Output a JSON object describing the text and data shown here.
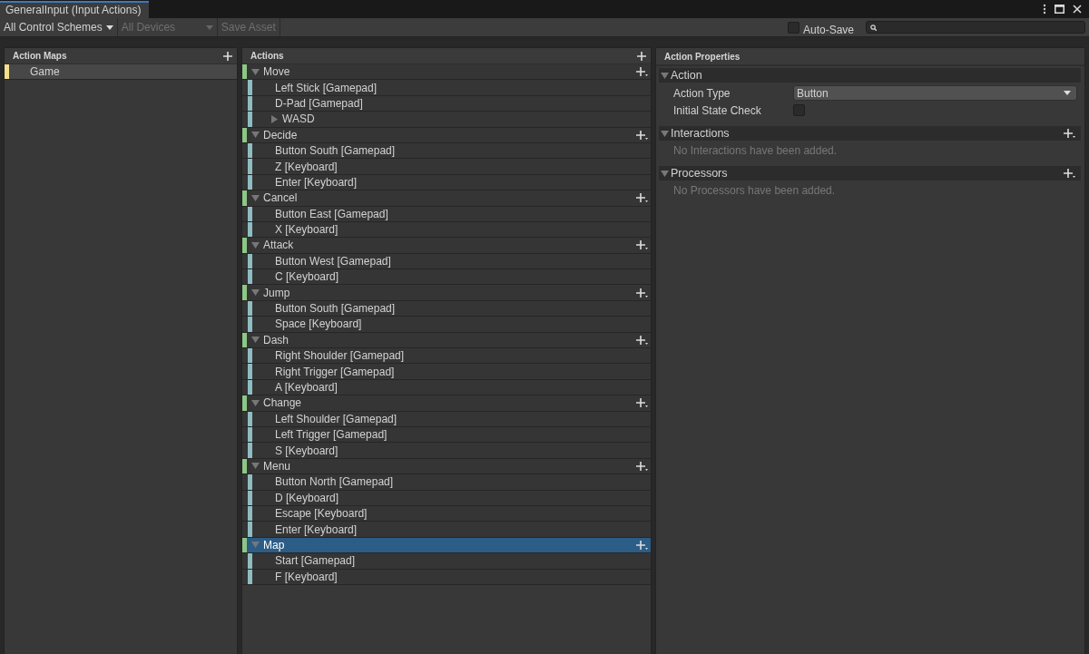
{
  "window": {
    "title": "GeneralInput (Input Actions)"
  },
  "toolbar": {
    "control_scheme": "All Control Schemes",
    "devices": "All Devices",
    "devices_disabled": true,
    "save_asset": "Save Asset",
    "save_disabled": true,
    "auto_save": {
      "label": "Auto-Save",
      "checked": false
    }
  },
  "action_maps": {
    "title": "Action Maps",
    "items": [
      {
        "name": "Game",
        "selected": false
      }
    ]
  },
  "actions": {
    "title": "Actions",
    "items": [
      {
        "name": "Move",
        "expanded": true,
        "selected": false,
        "children": [
          {
            "name": "Left Stick [Gamepad]"
          },
          {
            "name": "D-Pad [Gamepad]"
          },
          {
            "name": "WASD",
            "kind": "composite",
            "expanded": false
          }
        ]
      },
      {
        "name": "Decide",
        "expanded": true,
        "selected": false,
        "children": [
          {
            "name": "Button South [Gamepad]"
          },
          {
            "name": "Z [Keyboard]"
          },
          {
            "name": "Enter [Keyboard]"
          }
        ]
      },
      {
        "name": "Cancel",
        "expanded": true,
        "selected": false,
        "children": [
          {
            "name": "Button East [Gamepad]"
          },
          {
            "name": "X [Keyboard]"
          }
        ]
      },
      {
        "name": "Attack",
        "expanded": true,
        "selected": false,
        "children": [
          {
            "name": "Button West [Gamepad]"
          },
          {
            "name": "C [Keyboard]"
          }
        ]
      },
      {
        "name": "Jump",
        "expanded": true,
        "selected": false,
        "children": [
          {
            "name": "Button South [Gamepad]"
          },
          {
            "name": "Space [Keyboard]"
          }
        ]
      },
      {
        "name": "Dash",
        "expanded": true,
        "selected": false,
        "children": [
          {
            "name": "Right Shoulder [Gamepad]"
          },
          {
            "name": "Right Trigger [Gamepad]"
          },
          {
            "name": "A [Keyboard]"
          }
        ]
      },
      {
        "name": "Change",
        "expanded": true,
        "selected": false,
        "children": [
          {
            "name": "Left Shoulder [Gamepad]"
          },
          {
            "name": "Left Trigger [Gamepad]"
          },
          {
            "name": "S [Keyboard]"
          }
        ]
      },
      {
        "name": "Menu",
        "expanded": true,
        "selected": false,
        "children": [
          {
            "name": "Button North [Gamepad]"
          },
          {
            "name": "D [Keyboard]"
          },
          {
            "name": "Escape [Keyboard]"
          },
          {
            "name": "Enter [Keyboard]"
          }
        ]
      },
      {
        "name": "Map",
        "expanded": true,
        "selected": true,
        "children": [
          {
            "name": "Start [Gamepad]"
          },
          {
            "name": "F [Keyboard]"
          }
        ]
      }
    ]
  },
  "properties": {
    "title": "Action Properties",
    "sections": [
      {
        "title": "Action",
        "expanded": true,
        "addable": false,
        "fields": [
          {
            "kind": "dropdown",
            "label": "Action Type",
            "value": "Button"
          },
          {
            "kind": "checkbox",
            "label": "Initial State Check",
            "checked": false
          }
        ]
      },
      {
        "title": "Interactions",
        "expanded": true,
        "addable": true,
        "empty": "No Interactions have been added."
      },
      {
        "title": "Processors",
        "expanded": true,
        "addable": true,
        "empty": "No Processors have been added."
      }
    ]
  }
}
